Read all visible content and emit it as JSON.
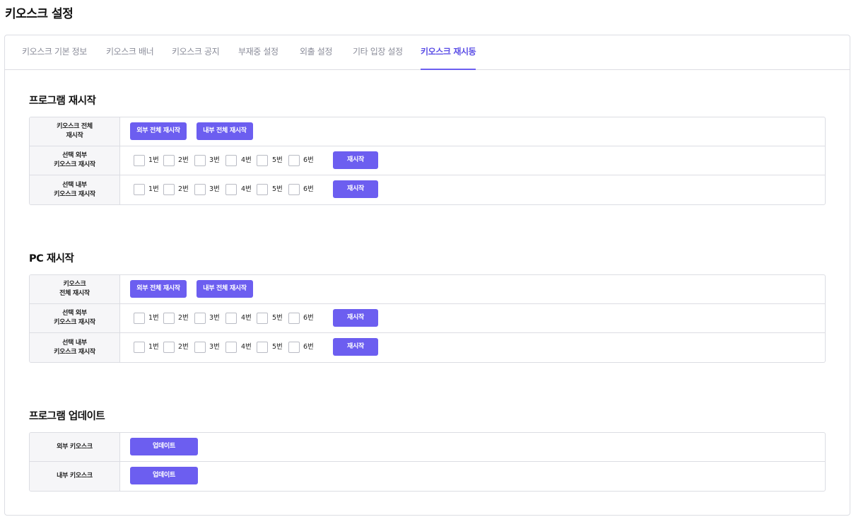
{
  "page": {
    "title": "키오스크 설정"
  },
  "tabs": [
    {
      "label": "키오스크 기본 정보"
    },
    {
      "label": "키오스크 배너"
    },
    {
      "label": "키오스크 공지"
    },
    {
      "label": "부재중 설정"
    },
    {
      "label": "외출 설정"
    },
    {
      "label": "기타 입장 설정"
    },
    {
      "label": "키오스크 재시동",
      "active": true
    }
  ],
  "program_restart": {
    "title": "프로그램 재시작",
    "all_row": {
      "label": "키오스크 전체\n재시작",
      "outer_all_btn": "외부 전체 재시작",
      "inner_all_btn": "내부 전체 재시작"
    },
    "outer_row": {
      "label": "선택 외부\n키오스크 재시작",
      "options": [
        "1번",
        "2번",
        "3번",
        "4번",
        "5번",
        "6번"
      ],
      "restart_btn": "재시작"
    },
    "inner_row": {
      "label": "선택 내부\n키오스크 재시작",
      "options": [
        "1번",
        "2번",
        "3번",
        "4번",
        "5번",
        "6번"
      ],
      "restart_btn": "재시작"
    }
  },
  "pc_restart": {
    "title": "PC 재시작",
    "all_row": {
      "label": "키오스크\n전체 재시작",
      "outer_all_btn": "외부 전체 재시작",
      "inner_all_btn": "내부 전체 재시작"
    },
    "outer_row": {
      "label": "선택 외부\n키오스크 재시작",
      "options": [
        "1번",
        "2번",
        "3번",
        "4번",
        "5번",
        "6번"
      ],
      "restart_btn": "재시작"
    },
    "inner_row": {
      "label": "선택 내부\n키오스크 재시작",
      "options": [
        "1번",
        "2번",
        "3번",
        "4번",
        "5번",
        "6번"
      ],
      "restart_btn": "재시작"
    }
  },
  "program_update": {
    "title": "프로그램 업데이트",
    "outer_row": {
      "label": "외부 키오스크",
      "update_btn": "업데이트"
    },
    "inner_row": {
      "label": "내부 키오스크",
      "update_btn": "업데이트"
    }
  },
  "colors": {
    "accent": "#6c5ef0",
    "active_tab": "#5b4ee6",
    "border": "#dcdde3",
    "label_bg": "#f6f6f8"
  }
}
